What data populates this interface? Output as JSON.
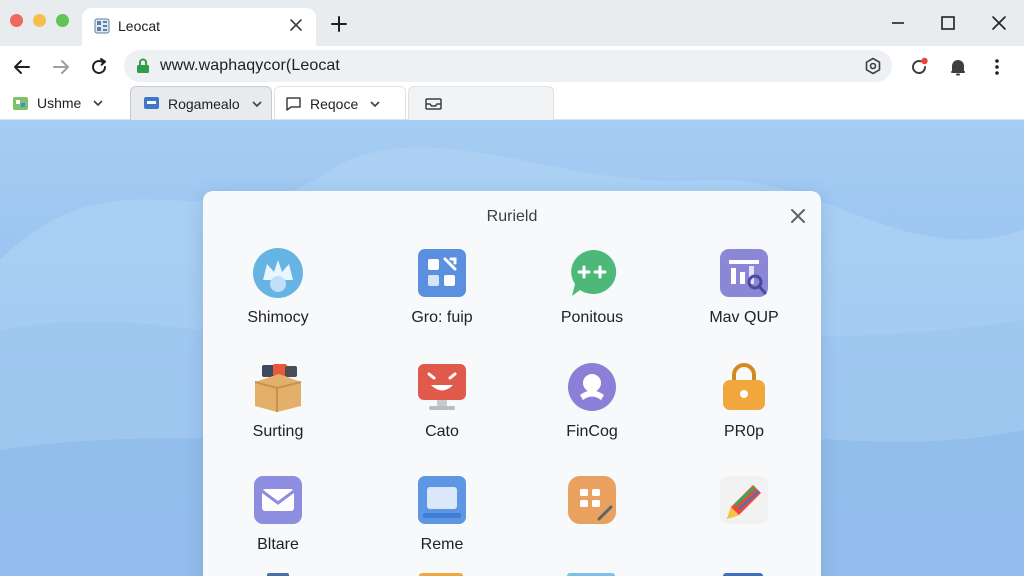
{
  "window": {
    "tab_title": "Leocat"
  },
  "address_bar": {
    "url": "www.waphaqycor(Leocat"
  },
  "bookmarks": [
    {
      "label": "Ushme"
    },
    {
      "label": "Rogamealo"
    },
    {
      "label": "Reqoce"
    },
    {
      "label": ""
    }
  ],
  "dialog": {
    "title": "Ruriеld",
    "apps": [
      {
        "label": "Shimocy",
        "icon": "crown-cloud-icon",
        "color": "#6fb8e6"
      },
      {
        "label": "Gro: fuip",
        "icon": "grid-tiles-icon",
        "color": "#5b8fe0"
      },
      {
        "label": "Ponitous",
        "icon": "chat-bubble-icon",
        "color": "#4cb97a"
      },
      {
        "label": "Mav QUP",
        "icon": "analytics-icon",
        "color": "#8a87d6"
      },
      {
        "label": "Surting",
        "icon": "box-icon",
        "color": "#e2b06a"
      },
      {
        "label": "Cato",
        "icon": "monitor-face-icon",
        "color": "#e05a4c"
      },
      {
        "label": "FinCog",
        "icon": "person-circle-icon",
        "color": "#8b7fd8"
      },
      {
        "label": "PR0p",
        "icon": "lock-bag-icon",
        "color": "#f0a83c"
      },
      {
        "label": "Bltare",
        "icon": "mail-icon",
        "color": "#8d8ee0"
      },
      {
        "label": "Rеme",
        "icon": "window-icon",
        "color": "#5d97e4"
      },
      {
        "label": "",
        "icon": "keypad-icon",
        "color": "#e8a15f"
      },
      {
        "label": "",
        "icon": "pencil-icon",
        "color": "#e84b3d"
      }
    ]
  }
}
